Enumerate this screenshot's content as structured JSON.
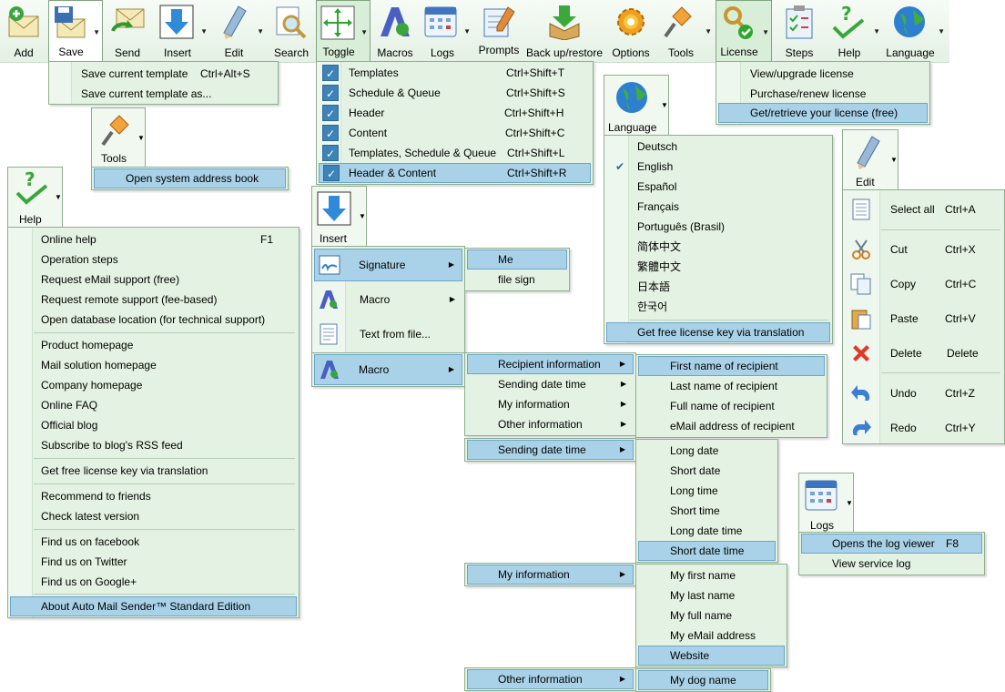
{
  "toolbar": {
    "add": "Add",
    "save": "Save",
    "send": "Send",
    "insert": "Insert",
    "edit": "Edit",
    "search": "Search",
    "toggle": "Toggle",
    "macros": "Macros",
    "logs": "Logs",
    "prompts": "Prompts",
    "backup": "Back up/restore",
    "options": "Options",
    "tools": "Tools",
    "license": "License",
    "steps": "Steps",
    "help": "Help",
    "language": "Language"
  },
  "save_menu": [
    {
      "label": "Save current template",
      "shortcut": "Ctrl+Alt+S"
    },
    {
      "label": "Save current template as...",
      "shortcut": ""
    }
  ],
  "tools_caption": "Tools",
  "tools_menu": [
    {
      "label": "Open system address book"
    }
  ],
  "toggle_menu": [
    {
      "label": "Templates",
      "shortcut": "Ctrl+Shift+T"
    },
    {
      "label": "Schedule & Queue",
      "shortcut": "Ctrl+Shift+S"
    },
    {
      "label": "Header",
      "shortcut": "Ctrl+Shift+H"
    },
    {
      "label": "Content",
      "shortcut": "Ctrl+Shift+C"
    },
    {
      "label": "Templates, Schedule & Queue",
      "shortcut": "Ctrl+Shift+L"
    },
    {
      "label": "Header & Content",
      "shortcut": "Ctrl+Shift+R"
    }
  ],
  "license_menu": [
    {
      "label": "View/upgrade license"
    },
    {
      "label": "Purchase/renew license"
    },
    {
      "label": "Get/retrieve your license (free)"
    }
  ],
  "language_caption": "Language",
  "language_menu": [
    {
      "label": "Deutsch"
    },
    {
      "label": "English"
    },
    {
      "label": "Español"
    },
    {
      "label": "Français"
    },
    {
      "label": "Português (Brasil)"
    },
    {
      "label": "简体中文"
    },
    {
      "label": "繁體中文"
    },
    {
      "label": "日本語"
    },
    {
      "label": "한국어"
    },
    {
      "label": "Get free license key via translation"
    }
  ],
  "help_caption": "Help",
  "help_menu": [
    {
      "label": "Online help",
      "shortcut": "F1"
    },
    {
      "label": "Operation steps"
    },
    {
      "label": "Request eMail support (free)"
    },
    {
      "label": "Request remote support (fee-based)"
    },
    {
      "label": "Open database location (for technical support)"
    },
    {
      "label": "Product homepage"
    },
    {
      "label": "Mail solution homepage"
    },
    {
      "label": "Company homepage"
    },
    {
      "label": "Online FAQ"
    },
    {
      "label": "Official blog"
    },
    {
      "label": "Subscribe to blog's RSS feed"
    },
    {
      "label": "Get free license key via translation"
    },
    {
      "label": "Recommend to friends"
    },
    {
      "label": "Check latest version"
    },
    {
      "label": "Find us on facebook"
    },
    {
      "label": "Find us on Twitter"
    },
    {
      "label": "Find us on Google+"
    },
    {
      "label": "About Auto Mail Sender™ Standard Edition"
    }
  ],
  "insert_caption": "Insert",
  "insert_menu": [
    {
      "label": "Signature"
    },
    {
      "label": "Macro"
    },
    {
      "label": "Text from file..."
    }
  ],
  "signature_sub": [
    {
      "label": "Me"
    },
    {
      "label": "file sign"
    }
  ],
  "macro_button": "Macro",
  "macro_sub": [
    {
      "label": "Recipient information"
    },
    {
      "label": "Sending date time"
    },
    {
      "label": "My information"
    },
    {
      "label": "Other information"
    }
  ],
  "recipient_sub": [
    {
      "label": "First name of recipient"
    },
    {
      "label": "Last name of recipient"
    },
    {
      "label": "Full name of recipient"
    },
    {
      "label": "eMail address of recipient"
    }
  ],
  "sending_button": "Sending date time",
  "sending_sub": [
    {
      "label": "Long date"
    },
    {
      "label": "Short date"
    },
    {
      "label": "Long time"
    },
    {
      "label": "Short time"
    },
    {
      "label": "Long date time"
    },
    {
      "label": "Short date time"
    }
  ],
  "myinfo_button": "My information",
  "myinfo_sub": [
    {
      "label": "My first name"
    },
    {
      "label": "My last name"
    },
    {
      "label": "My full name"
    },
    {
      "label": "My eMail address"
    },
    {
      "label": "Website"
    }
  ],
  "other_button": "Other information",
  "other_sub": [
    {
      "label": "My dog name"
    }
  ],
  "edit_caption": "Edit",
  "edit_menu": [
    {
      "label": "Select all",
      "shortcut": "Ctrl+A"
    },
    {
      "label": "Cut",
      "shortcut": "Ctrl+X"
    },
    {
      "label": "Copy",
      "shortcut": "Ctrl+C"
    },
    {
      "label": "Paste",
      "shortcut": "Ctrl+V"
    },
    {
      "label": "Delete",
      "shortcut": "Delete"
    },
    {
      "label": "Undo",
      "shortcut": "Ctrl+Z"
    },
    {
      "label": "Redo",
      "shortcut": "Ctrl+Y"
    }
  ],
  "logs_caption": "Logs",
  "logs_menu": [
    {
      "label": "Opens the log viewer",
      "shortcut": "F8"
    },
    {
      "label": "View service log"
    }
  ]
}
